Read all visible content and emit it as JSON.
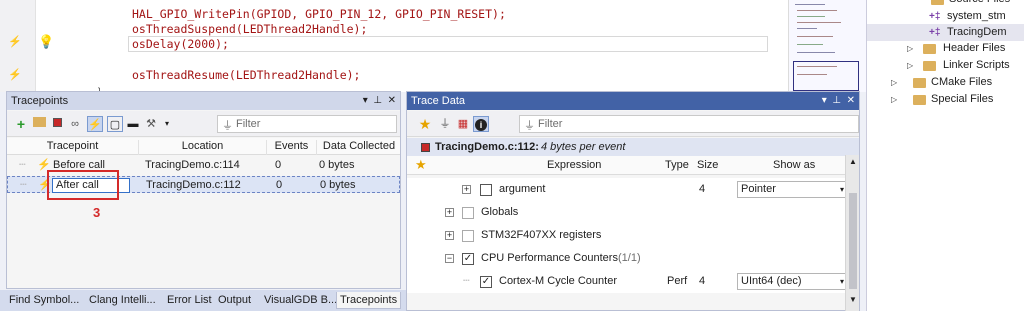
{
  "editor": {
    "lines": [
      {
        "text": "HAL_GPIO_WritePin(GPIOD, GPIO_PIN_12, GPIO_PIN_RESET);",
        "current": false
      },
      {
        "text": "osThreadSuspend(LEDThread2Handle);",
        "current": false
      },
      {
        "text": "osDelay(2000);",
        "current": true
      },
      {
        "text": "",
        "current": false
      },
      {
        "text": "osThreadResume(LEDThread2Handle);",
        "current": false
      }
    ]
  },
  "solution": {
    "items": [
      {
        "label": "Source Files",
        "kind": "folder"
      },
      {
        "label": "system_stm",
        "kind": "cpp"
      },
      {
        "label": "TracingDem",
        "kind": "cpp",
        "selected": true
      },
      {
        "label": "Header Files",
        "kind": "folder"
      },
      {
        "label": "Linker Scripts",
        "kind": "folder"
      },
      {
        "label": "CMake Files",
        "kind": "folder"
      },
      {
        "label": "Special Files",
        "kind": "folder"
      }
    ]
  },
  "tracepoints": {
    "title": "Tracepoints",
    "filter_placeholder": "Filter",
    "columns": [
      "Tracepoint",
      "Location",
      "Events",
      "Data Collected"
    ],
    "rows": [
      {
        "name": "Before call",
        "location": "TracingDemo.c:114",
        "events": "0",
        "data": "0 bytes"
      },
      {
        "name": "After call",
        "location": "TracingDemo.c:112",
        "events": "0",
        "data": "0 bytes",
        "editing": true
      }
    ]
  },
  "annotation": {
    "number": "3",
    "color": "#d42a2a"
  },
  "tracedata": {
    "title": "Trace Data",
    "filter_placeholder": "Filter",
    "subheader_file": "TracingDemo.c:112:",
    "subheader_note": "4 bytes per event",
    "columns": [
      "Expression",
      "Type",
      "Size",
      "Show as"
    ],
    "rows": [
      {
        "label": "argument",
        "indent": 2,
        "checked": false,
        "type": "",
        "size": "4",
        "show_as": "Pointer",
        "expander": "+"
      },
      {
        "label": "Globals",
        "indent": 1,
        "checked": false,
        "type": "",
        "size": "",
        "show_as": "",
        "expander": "+"
      },
      {
        "label": "STM32F407XX registers",
        "indent": 1,
        "checked": false,
        "type": "",
        "size": "",
        "show_as": "",
        "expander": "+"
      },
      {
        "label": "CPU Performance Counters",
        "count": "(1/1)",
        "indent": 1,
        "checked": true,
        "type": "",
        "size": "",
        "show_as": "",
        "expander": "-"
      },
      {
        "label": "Cortex-M Cycle Counter",
        "indent": 2,
        "checked": true,
        "type": "Perf",
        "size": "4",
        "show_as": "UInt64 (dec)",
        "expander": ""
      }
    ]
  },
  "bottom_tabs": [
    "Find Symbol...",
    "Clang Intelli...",
    "Error List",
    "Output",
    "VisualGDB B...",
    "Tracepoints"
  ],
  "active_tab": "Tracepoints",
  "colors": {
    "accent": "#4262a6",
    "annotation": "#d42a2a"
  }
}
